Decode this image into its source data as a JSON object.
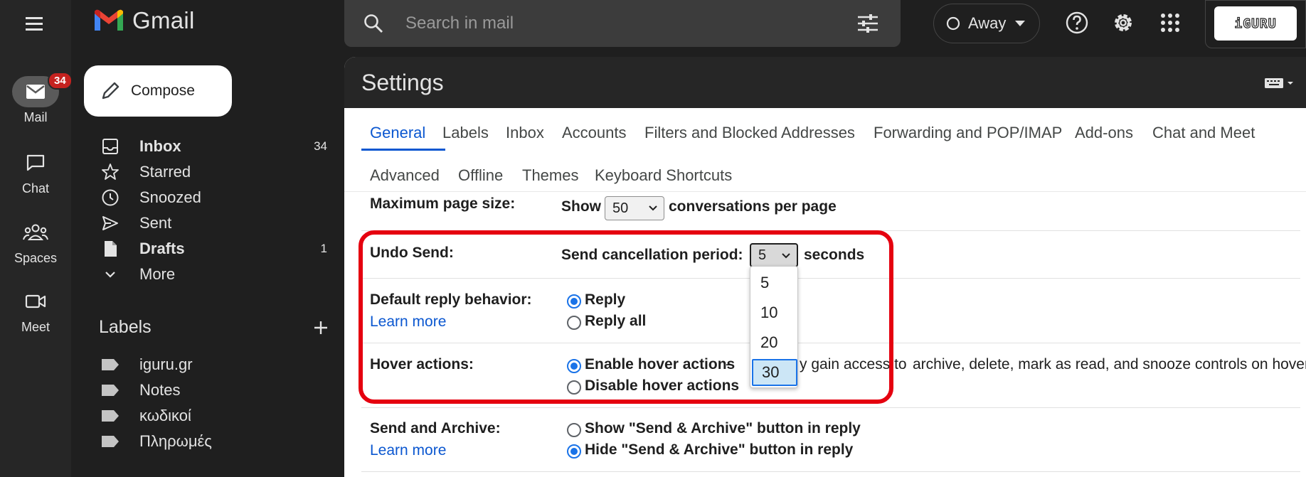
{
  "rail": {
    "items": [
      {
        "label": "Mail",
        "badge": "34"
      },
      {
        "label": "Chat"
      },
      {
        "label": "Spaces"
      },
      {
        "label": "Meet"
      }
    ]
  },
  "brand": {
    "name": "Gmail"
  },
  "compose": {
    "label": "Compose"
  },
  "nav": {
    "items": [
      {
        "label": "Inbox",
        "count": "34"
      },
      {
        "label": "Starred"
      },
      {
        "label": "Snoozed"
      },
      {
        "label": "Sent"
      },
      {
        "label": "Drafts",
        "count": "1"
      },
      {
        "label": "More"
      }
    ]
  },
  "labels": {
    "heading": "Labels",
    "items": [
      "iguru.gr",
      "Notes",
      "κωδικοί",
      "Πληρωμές"
    ]
  },
  "search": {
    "placeholder": "Search in mail"
  },
  "status": {
    "label": "Away"
  },
  "account": {
    "logo_text": "iGURU"
  },
  "settings": {
    "title": "Settings",
    "tabs": [
      "General",
      "Labels",
      "Inbox",
      "Accounts",
      "Filters and Blocked Addresses",
      "Forwarding and POP/IMAP",
      "Add-ons",
      "Chat and Meet",
      "Advanced",
      "Offline",
      "Themes",
      "Keyboard Shortcuts"
    ],
    "active_tab": "General",
    "page_size": {
      "label": "Maximum page size:",
      "prefix": "Show",
      "value": "50",
      "suffix": "conversations per page"
    },
    "undo_send": {
      "label": "Undo Send:",
      "text": "Send cancellation period:",
      "value": "5",
      "suffix": "seconds",
      "options": [
        "5",
        "10",
        "20",
        "30"
      ],
      "highlighted_option": "30"
    },
    "reply": {
      "label": "Default reply behavior:",
      "link": "Learn more",
      "options": [
        "Reply",
        "Reply all"
      ],
      "selected": "Reply"
    },
    "hover": {
      "label": "Hover actions:",
      "enable": "Enable hover actions",
      "enable_desc_a": "- ",
      "enable_desc_b": "y gain access to ",
      "enable_desc_c": "archive, delete, mark as read, and snooze controls on hover.",
      "disable": "Disable hover actions",
      "selected": "Enable hover actions"
    },
    "send_archive": {
      "label": "Send and Archive:",
      "link": "Learn more",
      "options": [
        "Show \"Send & Archive\" button in reply",
        "Hide \"Send & Archive\" button in reply"
      ],
      "selected": "Hide"
    }
  },
  "colors": {
    "accent": "#0b57d0",
    "radio": "#1a73e8",
    "highlight_border": "#e5000f",
    "badge": "#c5221f"
  }
}
